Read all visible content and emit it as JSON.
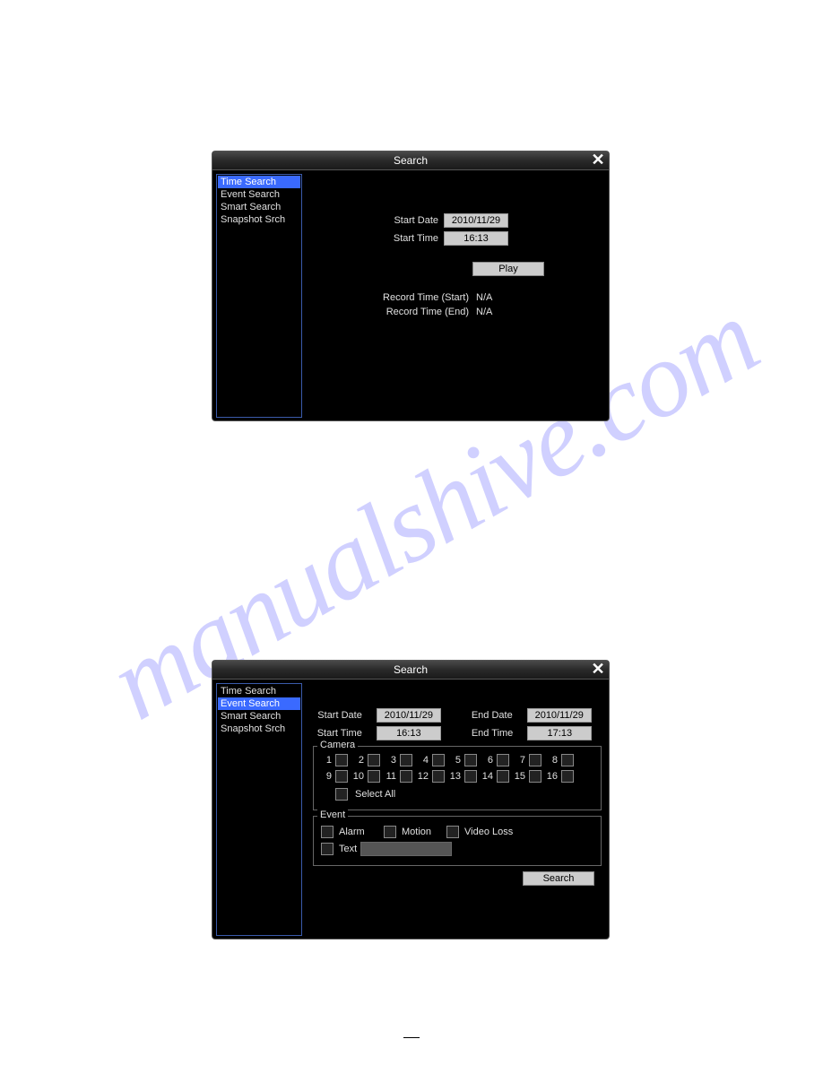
{
  "watermark": "manualshive.com",
  "dialog1": {
    "title": "Search",
    "sidebar": [
      "Time Search",
      "Event Search",
      "Smart Search",
      "Snapshot Srch"
    ],
    "selected": "Time Search",
    "start_date_label": "Start Date",
    "start_date_value": "2010/11/29",
    "start_time_label": "Start Time",
    "start_time_value": "16:13",
    "play_btn": "Play",
    "rec_start_label": "Record Time (Start)",
    "rec_start_value": "N/A",
    "rec_end_label": "Record Time (End)",
    "rec_end_value": "N/A"
  },
  "dialog2": {
    "title": "Search",
    "sidebar": [
      "Time Search",
      "Event Search",
      "Smart Search",
      "Snapshot Srch"
    ],
    "selected": "Event Search",
    "start_date_label": "Start Date",
    "start_date_value": "2010/11/29",
    "start_time_label": "Start Time",
    "start_time_value": "16:13",
    "end_date_label": "End Date",
    "end_date_value": "2010/11/29",
    "end_time_label": "End Time",
    "end_time_value": "17:13",
    "camera_group": "Camera",
    "camera_nums": [
      "1",
      "2",
      "3",
      "4",
      "5",
      "6",
      "7",
      "8",
      "9",
      "10",
      "11",
      "12",
      "13",
      "14",
      "15",
      "16"
    ],
    "select_all": "Select All",
    "event_group": "Event",
    "event_alarm": "Alarm",
    "event_motion": "Motion",
    "event_video_loss": "Video Loss",
    "event_text": "Text",
    "search_btn": "Search"
  }
}
